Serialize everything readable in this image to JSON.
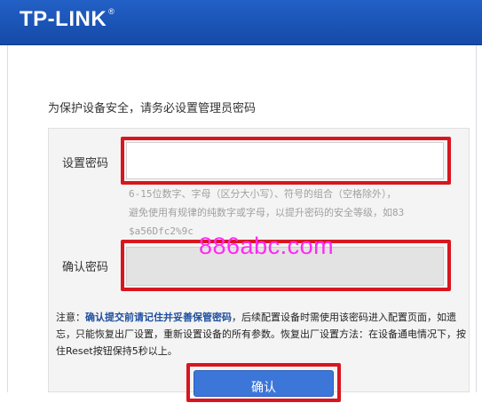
{
  "header": {
    "brand": "TP-LINK",
    "brand_mark": "®"
  },
  "prompt": "为保护设备安全，请务必设置管理员密码",
  "form": {
    "set_password_label": "设置密码",
    "set_password_value": "",
    "hint_line1": "6-15位数字、字母（区分大小写）、符号的组合（空格除外），",
    "hint_line2": "避免使用有规律的纯数字或字母，以提升密码的安全等级，如83",
    "hint_line3": "$a56Dfc2%9c",
    "confirm_password_label": "确认密码",
    "confirm_password_value": ""
  },
  "watermark": "886abc.com",
  "note": {
    "prefix": "注意：",
    "emphasis": "确认提交前请记住并妥善保管密码",
    "rest": "，后续配置设备时需使用该密码进入配置页面，如遗忘，只能恢复出厂设置，重新设置设备的所有参数。恢复出厂设置方法：在设备通电情况下，按住Reset按钮保持5秒以上。"
  },
  "confirm_button": "确认",
  "colors": {
    "header": "#1b54b9",
    "highlight": "#d8161f",
    "button": "#3d76d9",
    "watermark": "#ff2af2"
  }
}
